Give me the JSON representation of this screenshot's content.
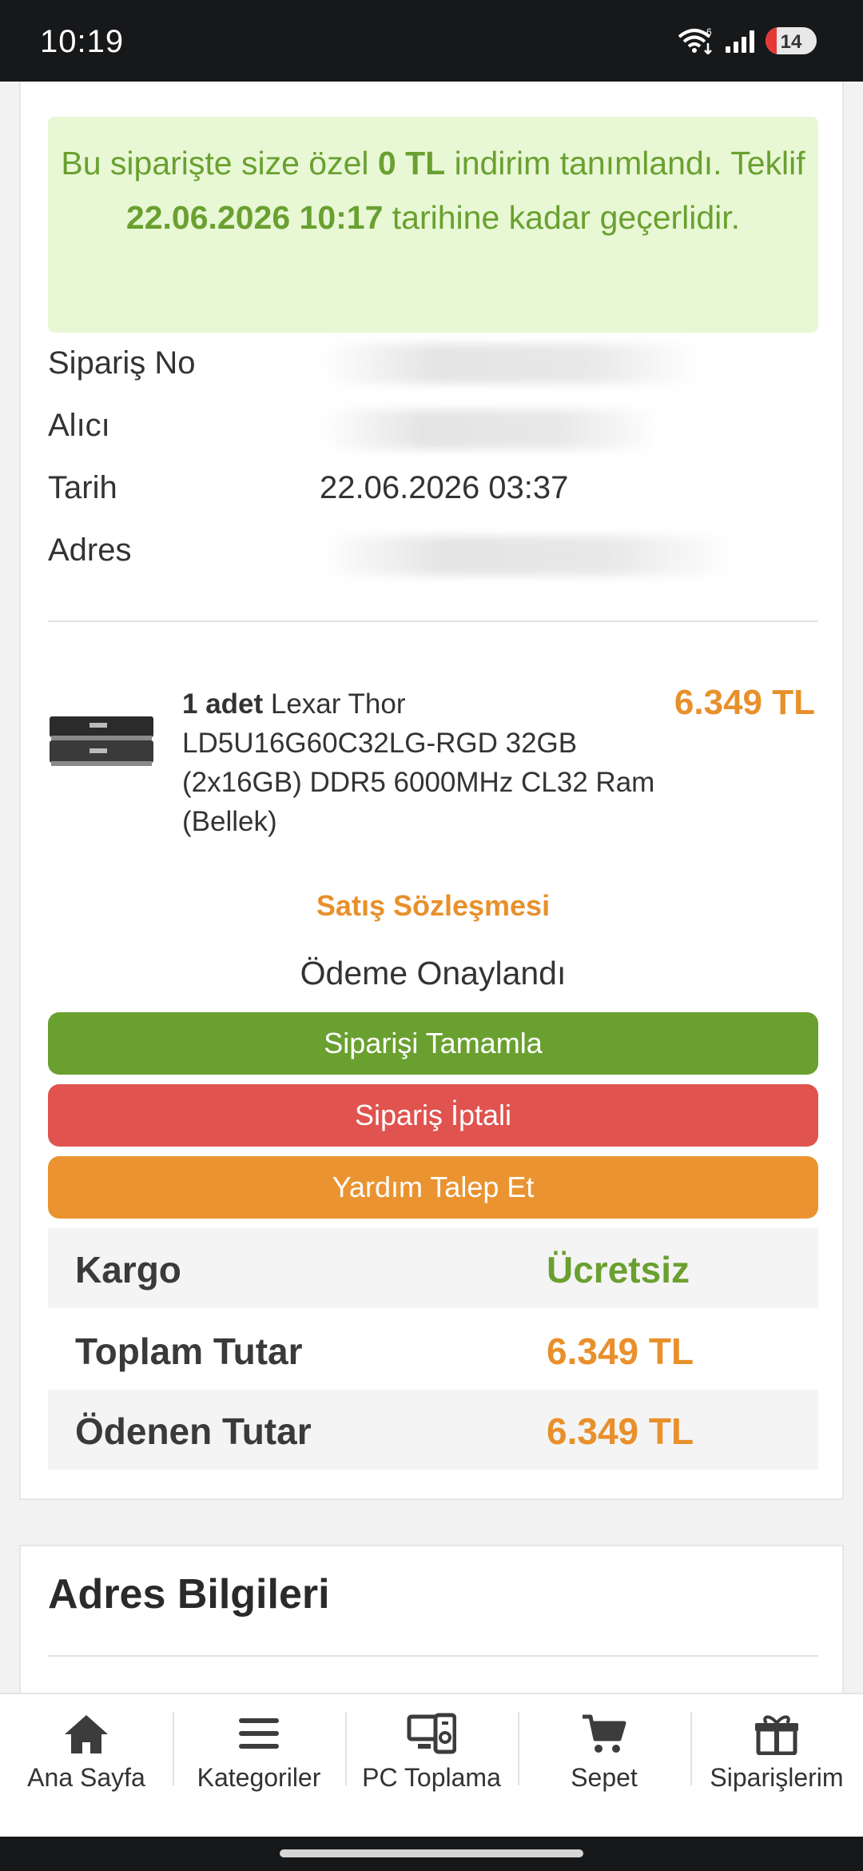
{
  "statusbar": {
    "time": "10:19",
    "wifi_badge": "6",
    "battery": "14"
  },
  "promo": {
    "p1": "Bu siparişte size özel ",
    "amount": "0 TL",
    "p2": " indirim tanımlandı. Teklif ",
    "deadline": "22.06.2026 10:17",
    "p3": " tarihine kadar geçerlidir."
  },
  "order_info": {
    "order_no_label": "Sipariş No",
    "recipient_label": "Alıcı",
    "date_label": "Tarih",
    "date_value": "22.06.2026 03:37",
    "address_label": "Adres"
  },
  "product": {
    "quantity": "1 adet",
    "name": " Lexar Thor LD5U16G60C32LG-RGD 32GB (2x16GB) DDR5 6000MHz CL32 Ram (Bellek)",
    "price": "6.349 TL"
  },
  "contract_link": "Satış Sözleşmesi",
  "payment_status": "Ödeme Onaylandı",
  "buttons": {
    "complete": "Siparişi Tamamla",
    "cancel": "Sipariş İptali",
    "help": "Yardım Talep Et"
  },
  "summary": [
    {
      "label": "Kargo",
      "value": "Ücretsiz"
    },
    {
      "label": "Toplam Tutar",
      "value": "6.349 TL"
    },
    {
      "label": "Ödenen Tutar",
      "value": "6.349 TL"
    }
  ],
  "address_section": {
    "title": "Adres Bilgileri"
  },
  "bottom_nav": [
    {
      "label": "Ana Sayfa",
      "icon": "home-icon"
    },
    {
      "label": "Kategoriler",
      "icon": "menu-icon"
    },
    {
      "label": "PC Toplama",
      "icon": "pc-build-icon"
    },
    {
      "label": "Sepet",
      "icon": "cart-icon"
    },
    {
      "label": "Siparişlerim",
      "icon": "gift-box-icon"
    }
  ],
  "colors": {
    "green": "#6aa030",
    "red": "#e0534e",
    "orange": "#ea9330",
    "promo_bg": "#e8f8d5"
  }
}
